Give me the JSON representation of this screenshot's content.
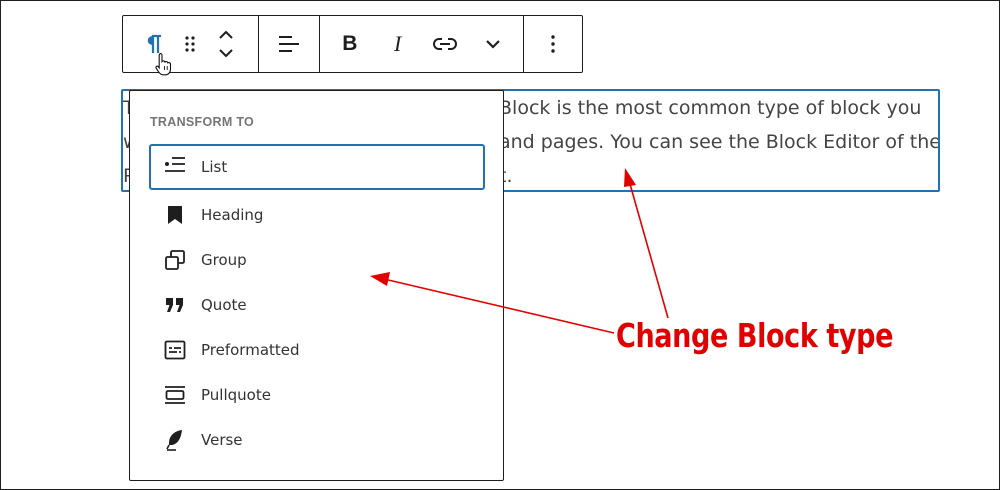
{
  "toolbar": {
    "buttons": [
      {
        "name": "paragraph-block-type-button",
        "icon": "pilcrow-icon"
      },
      {
        "name": "drag-handle-button",
        "icon": "drag-dots-icon"
      },
      {
        "name": "move-up-down-button",
        "icon": "chevron-up-down-icon"
      },
      {
        "name": "align-button",
        "icon": "align-left-icon"
      },
      {
        "name": "bold-button",
        "label": "B"
      },
      {
        "name": "italic-button",
        "label": "I"
      },
      {
        "name": "link-button",
        "icon": "link-icon"
      },
      {
        "name": "more-formatting-button",
        "icon": "chevron-down-icon"
      },
      {
        "name": "options-button",
        "icon": "vertical-ellipsis-icon"
      }
    ],
    "accent_color": "#2271b1"
  },
  "paragraph": {
    "line1_prefix": "T",
    "line1_suffix": "Block is the most common type of block you",
    "line2_prefix": "w",
    "line2_suffix": "and pages. You can see the Block Editor of the",
    "line3_prefix": "P",
    "line3_suffix": "t."
  },
  "transform_menu": {
    "title": "TRANSFORM TO",
    "items": [
      {
        "label": "List",
        "icon": "list-icon",
        "focused": true
      },
      {
        "label": "Heading",
        "icon": "bookmark-icon",
        "focused": false
      },
      {
        "label": "Group",
        "icon": "group-icon",
        "focused": false
      },
      {
        "label": "Quote",
        "icon": "quote-icon",
        "focused": false
      },
      {
        "label": "Preformatted",
        "icon": "preformatted-icon",
        "focused": false
      },
      {
        "label": "Pullquote",
        "icon": "pullquote-icon",
        "focused": false
      },
      {
        "label": "Verse",
        "icon": "feather-icon",
        "focused": false
      }
    ]
  },
  "annotation": {
    "text": "Change Block type",
    "color": "#e00000"
  }
}
